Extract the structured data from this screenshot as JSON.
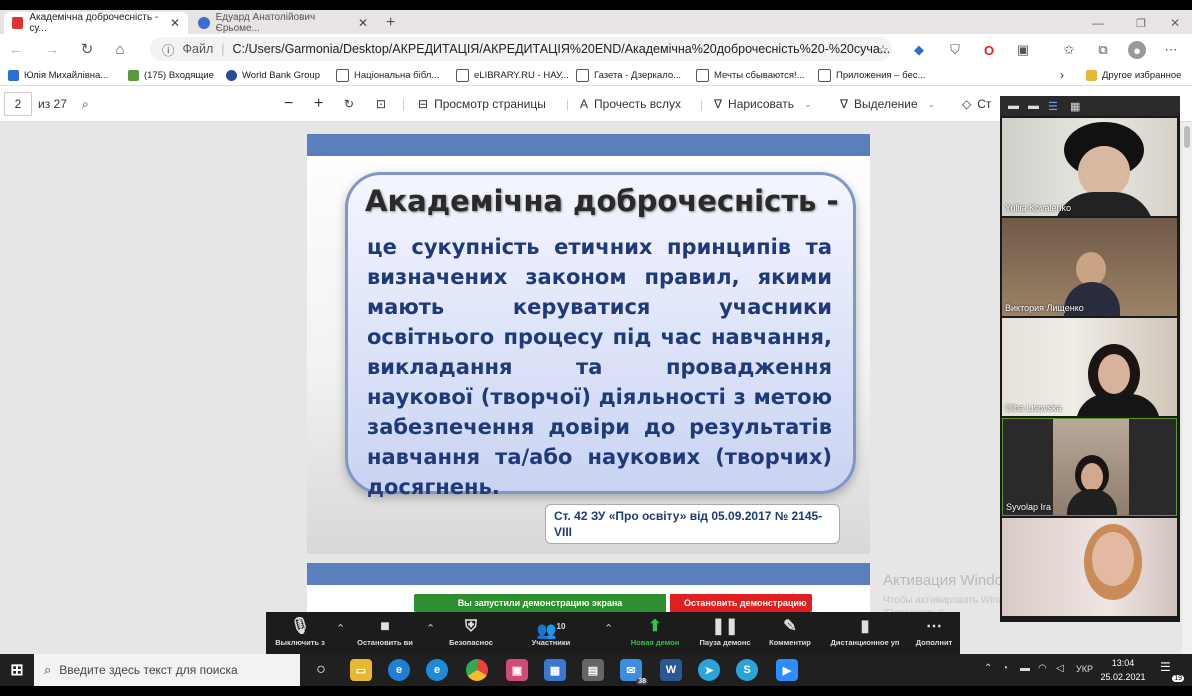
{
  "tabs": [
    {
      "title": "Академічна доброчесність - су...",
      "active": true
    },
    {
      "title": "Едуард Анатолійович Єрьоме...",
      "active": false
    }
  ],
  "address": {
    "prefix": "Файл",
    "url": "C:/Users/Garmonia/Desktop/АКРЕДИТАЦІЯ/АКРЕДИТАЦІЯ%20END/Академічна%20доброчесність%20-%20суча..."
  },
  "bookmarks": [
    "Юлія Михайлівна...",
    "(175) Входящие",
    "World Bank Group",
    "Національна бібл...",
    "eLIBRARY.RU - НАУ...",
    "Газета - Дзеркало...",
    "Мечты сбываются!...",
    "Приложения – бес...",
    "Другое избранное"
  ],
  "pdf_toolbar": {
    "page": "2",
    "of": "из 27",
    "view": "Просмотр страницы",
    "read": "Прочесть вслух",
    "draw": "Нарисовать",
    "highlight": "Выделение",
    "erase": "Ст"
  },
  "slide": {
    "title": "Академічна доброчесність -",
    "body": "це сукупність етичних принципів та визначених законом правил, якими мають керуватися учасники освітнього процесу під час навчання, викладання та провадження наукової (творчої) діяльності з метою забезпечення довіри до результатів навчання та/або наукових (творчих) досягнень.",
    "citation": "Ст. 42 ЗУ «Про освіту» від 05.09.2017 № 2145-VIII"
  },
  "watermark": {
    "title": "Активация Windows",
    "sub": "Чтобы активировать Windows, перейдите в раздел \"Параметры\"."
  },
  "share_banner": {
    "status": "Вы запустили демонстрацию экрана",
    "stop": "Остановить демонстрацию"
  },
  "zoom_toolbar": [
    {
      "label": "Выключить з",
      "icon": "microphone-icon"
    },
    {
      "label": "Остановить ви",
      "icon": "camera-icon"
    },
    {
      "label": "Безопаснос",
      "icon": "shield-icon"
    },
    {
      "label": "Участники",
      "icon": "participants-icon",
      "count": "10"
    },
    {
      "label": "Новая демон",
      "icon": "share-icon"
    },
    {
      "label": "Пауза демонс",
      "icon": "pause-icon"
    },
    {
      "label": "Комментир",
      "icon": "pencil-icon"
    },
    {
      "label": "Дистанционное уп",
      "icon": "remote-control-icon"
    },
    {
      "label": "Дополнит",
      "icon": "more-icon"
    }
  ],
  "participants": [
    "Yuliia Kovalenko",
    "Виктория Лищенко",
    "Olha Lisovska",
    "Syvolap Ira",
    ""
  ],
  "taskbar": {
    "search_placeholder": "Введите здесь текст для поиска",
    "lang": "УКР",
    "time": "13:04",
    "date": "25.02.2021",
    "notif": "19",
    "badge": "38"
  }
}
